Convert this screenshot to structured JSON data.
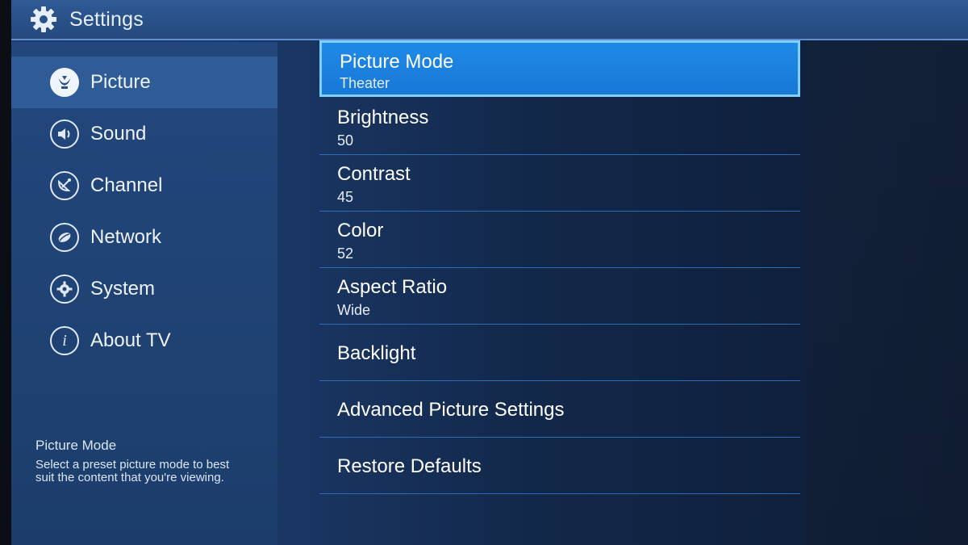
{
  "header": {
    "title": "Settings",
    "icon": "gear-icon"
  },
  "sidebar": {
    "items": [
      {
        "label": "Picture",
        "icon": "picture-icon",
        "active": true
      },
      {
        "label": "Sound",
        "icon": "speaker-icon",
        "active": false
      },
      {
        "label": "Channel",
        "icon": "satellite-dish-icon",
        "active": false
      },
      {
        "label": "Network",
        "icon": "network-icon",
        "active": false
      },
      {
        "label": "System",
        "icon": "gear-icon",
        "active": false
      },
      {
        "label": "About TV",
        "icon": "info-icon",
        "active": false
      }
    ],
    "help": {
      "title": "Picture Mode",
      "text": "Select a preset picture mode to best suit the content that you're viewing."
    }
  },
  "menu": {
    "items": [
      {
        "title": "Picture Mode",
        "value": "Theater",
        "selected": true
      },
      {
        "title": "Brightness",
        "value": "50"
      },
      {
        "title": "Contrast",
        "value": "45"
      },
      {
        "title": "Color",
        "value": "52"
      },
      {
        "title": "Aspect Ratio",
        "value": "Wide"
      },
      {
        "title": "Backlight",
        "value": ""
      },
      {
        "title": "Advanced Picture Settings",
        "value": ""
      },
      {
        "title": "Restore Defaults",
        "value": ""
      }
    ]
  },
  "colors": {
    "selection": "#1f8ae6",
    "selection_border": "#7fd0ff",
    "sidebar_active": "#2f5c97",
    "header": "#2f5a95"
  }
}
